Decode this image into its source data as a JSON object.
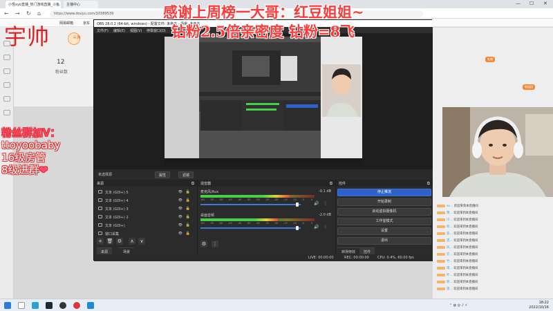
{
  "browser": {
    "tabs": [
      {
        "label": "小怪xyo直播_热门游戏直播_斗鱼..."
      },
      {
        "label": "主播中心"
      }
    ],
    "url": "https://www.douyu.com/10389539",
    "bookmarks": [
      "斗鱼",
      "录制",
      "网易邮箱",
      "京东",
      "淘宝"
    ]
  },
  "overlay": {
    "streamer_name": "宇帅",
    "thanks_line": "感谢上周榜一大哥：红豆姐姐~",
    "diamond_line": "钻粉2.5倍亲密度 钻粉=8飞",
    "fans_title": "粉丝群加V：",
    "fans_lines": [
      "ttoyoobaby",
      "16级房管",
      "8级进群"
    ],
    "heart": "❤"
  },
  "left_panel": {
    "number": "12",
    "small_text": "粉丝数",
    "badge": "斗鱼"
  },
  "obs": {
    "title": "OBS 28.0.2 (64-bit, windows) - 配置文件: 未命名 - 场景: 未命名",
    "menu": [
      "文件(F)",
      "编辑(E)",
      "视图(V)",
      "停靠窗口(D)",
      "配置文件(P)",
      "场景集合(S)",
      "工具(T)",
      "帮助(H)"
    ],
    "scene_bar": {
      "status": "未选择源",
      "properties": "属性",
      "filters": "滤镜"
    },
    "sources_dock": {
      "title": "来源",
      "items": [
        "文本 (GDI+) 5",
        "文本 (GDI+) 4",
        "文本 (GDI+) 3",
        "文本 (GDI+) 2",
        "文本 (GDI+)",
        "窗口采集"
      ],
      "tab_sources": "来源",
      "tab_scenes": "场景"
    },
    "mixer_dock": {
      "title": "混音器",
      "channels": [
        {
          "name": "麦克风/Aux",
          "db": "-0.1 dB",
          "level": 0.78
        },
        {
          "name": "桌面音频",
          "db": "-2.0 dB",
          "level": 0.68
        }
      ],
      "scale": [
        "-60",
        "-55",
        "-50",
        "-45",
        "-40",
        "-35",
        "-30",
        "-25",
        "-20",
        "-15",
        "-10",
        "-5",
        "0"
      ]
    },
    "controls_dock": {
      "title": "控件",
      "buttons": [
        "停止推流",
        "开始录制",
        "启动虚拟摄像机",
        "工作室模式",
        "设置",
        "退出"
      ],
      "tab_transitions": "转场特效",
      "tab_controls": "控件"
    },
    "status": {
      "live": "LIVE: 00:00:00",
      "rec": "REC: 00:00:00",
      "cpu": "CPU: 0.4%, 60.00 fps"
    }
  },
  "chat": {
    "tags": [
      "礼物",
      "粉丝团"
    ],
    "messages": [
      {
        "name": "sx…",
        "text": "欢迎来到本直播间"
      },
      {
        "name": "萧…",
        "text": "欢迎来到本直播间"
      },
      {
        "name": "冷…",
        "text": "欢迎来到本直播间"
      },
      {
        "name": "阿…",
        "text": "欢迎来到本直播间"
      },
      {
        "name": "浪…",
        "text": "欢迎来到本直播间"
      },
      {
        "name": "黑…",
        "text": "欢迎来到本直播间"
      },
      {
        "name": "风…",
        "text": "欢迎来到本直播间"
      },
      {
        "name": "云…",
        "text": "欢迎来到本直播间"
      },
      {
        "name": "竹…",
        "text": "欢迎来到本直播间"
      },
      {
        "name": "雨…",
        "text": "欢迎来到本直播间"
      },
      {
        "name": "叶…",
        "text": "欢迎来到本直播间"
      },
      {
        "name": "明…",
        "text": "欢迎来到本直播间"
      },
      {
        "name": "夜…",
        "text": "欢迎来到本直播间"
      }
    ]
  },
  "taskbar": {
    "time": "18:22",
    "date": "2022/10/16"
  },
  "colors": {
    "accent_blue": "#2f62c9",
    "overlay_red": "#ff3a3a"
  }
}
